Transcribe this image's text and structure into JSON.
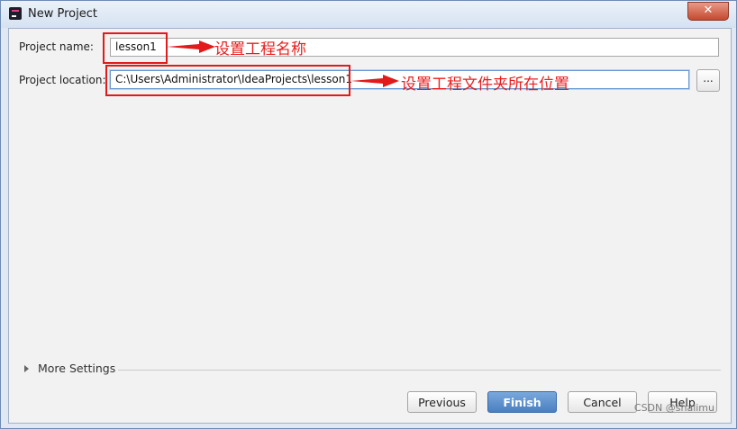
{
  "window": {
    "title": "New Project",
    "close_glyph": "✕"
  },
  "form": {
    "project_name_label": "Project name:",
    "project_name_value": "lesson1",
    "project_location_label": "Project location:",
    "project_location_value": "C:\\Users\\Administrator\\IdeaProjects\\lesson1",
    "browse_label": "..."
  },
  "annotations": {
    "name_note": "设置工程名称",
    "location_note": "设置工程文件夹所在位置",
    "color": "#e11a1a"
  },
  "more_settings": {
    "label": "More Settings"
  },
  "buttons": {
    "previous": "Previous",
    "finish": "Finish",
    "cancel": "Cancel",
    "help": "Help"
  },
  "watermark": "CSDN @shalimu",
  "icons": {
    "app": "intellij-app-icon",
    "close": "close-icon",
    "expander": "triangle-right-icon",
    "arrow": "red-arrow-icon"
  }
}
